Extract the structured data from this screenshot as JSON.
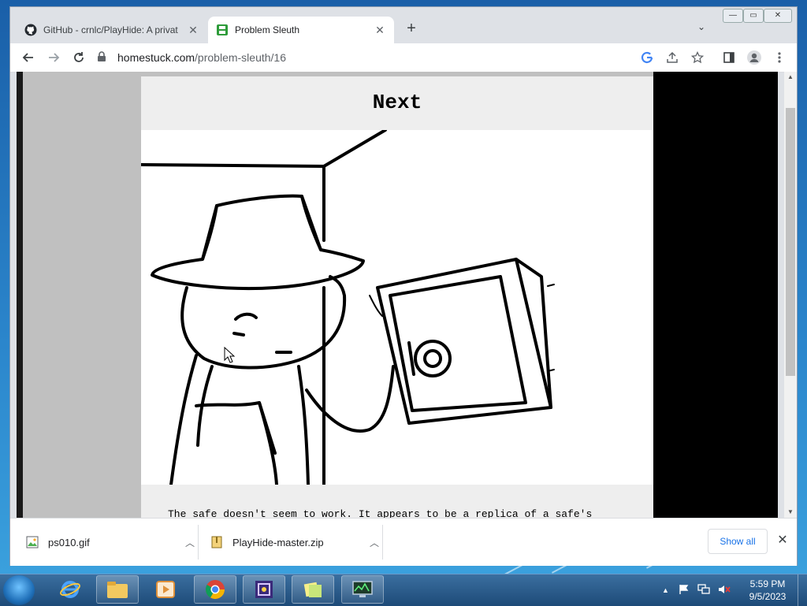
{
  "browser": {
    "tabs": [
      {
        "title": "GitHub - crnlc/PlayHide: A privat",
        "icon": "github-icon"
      },
      {
        "title": "Problem Sleuth",
        "icon": "mspa-favicon-icon"
      }
    ],
    "new_tab_label": "+",
    "tab_search_label": "⌄",
    "window_controls": {
      "minimize": "—",
      "maximize": "▭",
      "close": "✕"
    },
    "url_host": "homestuck.com",
    "url_path": "/problem-sleuth/16"
  },
  "page": {
    "headline": "Next",
    "caption": "The safe doesn't seem to work. It appears to be a replica of a safe's"
  },
  "downloads": [
    {
      "filename": "ps010.gif",
      "icon": "image-file-icon"
    },
    {
      "filename": "PlayHide-master.zip",
      "icon": "zip-file-icon"
    }
  ],
  "download_bar": {
    "show_all_label": "Show all",
    "close_label": "✕"
  },
  "taskbar": {
    "apps": [
      "internet-explorer-icon",
      "file-explorer-icon",
      "media-player-icon",
      "chrome-icon",
      "app-icon",
      "sticky-notes-icon",
      "network-monitor-icon"
    ],
    "tray_expand": "▲",
    "time": "5:59 PM",
    "date": "9/5/2023"
  },
  "colors": {
    "accent": "#1a73e8",
    "page_bg": "#eeeeee",
    "side_gray": "#c0c0c0"
  }
}
